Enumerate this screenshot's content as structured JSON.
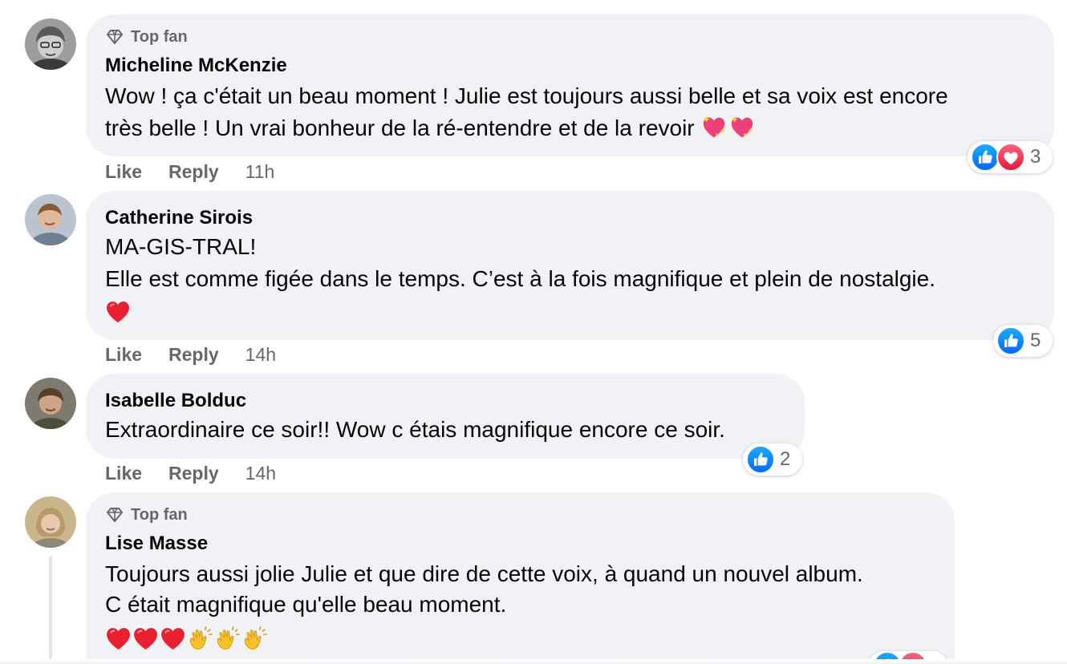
{
  "comments": [
    {
      "top_fan_label": "Top fan",
      "author": "Micheline McKenzie",
      "lines": [
        "Wow ! ça c'était un beau moment ! Julie est toujours aussi belle et sa voix est encore",
        "très belle ! Un vrai bonheur de la ré-entendre et de la revoir"
      ],
      "emojis": [
        "sparkling-heart",
        "sparkling-heart"
      ],
      "like_label": "Like",
      "reply_label": "Reply",
      "time": "11h",
      "reactions": [
        "like",
        "love"
      ],
      "reaction_count": "3"
    },
    {
      "author": "Catherine Sirois",
      "lines": [
        "MA-GIS-TRAL!",
        "Elle est comme figée dans le temps. C’est à la fois magnifique et plein de nostalgie."
      ],
      "emojis": [
        "red-heart"
      ],
      "like_label": "Like",
      "reply_label": "Reply",
      "time": "14h",
      "reactions": [
        "like"
      ],
      "reaction_count": "5"
    },
    {
      "author": "Isabelle Bolduc",
      "lines": [
        "Extraordinaire ce soir!! Wow c étais magnifique encore ce soir."
      ],
      "like_label": "Like",
      "reply_label": "Reply",
      "time": "14h",
      "reactions": [
        "like"
      ],
      "reaction_count": "2"
    },
    {
      "top_fan_label": "Top fan",
      "author": "Lise Masse",
      "lines": [
        "Toujours aussi jolie Julie et que dire de cette voix, à quand un nouvel album.",
        "C était magnifique qu'elle beau moment."
      ],
      "emojis": [
        "red-heart",
        "red-heart",
        "red-heart",
        "clapping-hands",
        "clapping-hands",
        "clapping-hands"
      ],
      "reactions": [
        "like",
        "love"
      ]
    }
  ],
  "colors": {
    "bubble": "#f0f2f5",
    "secondary_text": "#65676b",
    "like_blue": "#1877f2",
    "love_red": "#f33e58"
  }
}
